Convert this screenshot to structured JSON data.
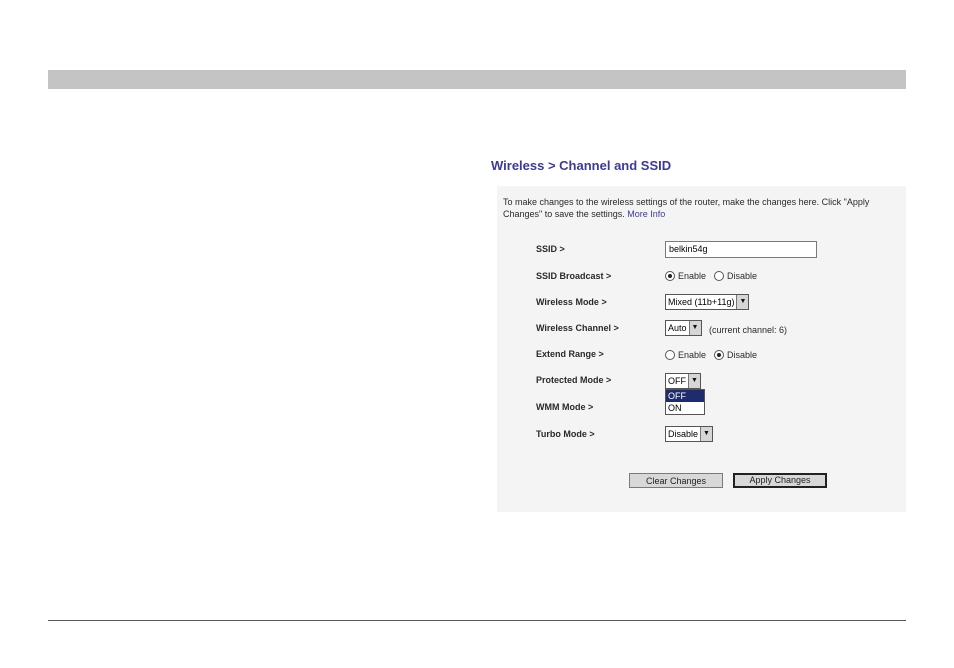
{
  "page": {
    "title": "Wireless > Channel and SSID",
    "intro": "To make changes to the wireless settings of the router, make the changes here. Click \"Apply Changes\" to save the settings.",
    "more_info": "More Info"
  },
  "fields": {
    "ssid": {
      "label": "SSID >",
      "value": "belkin54g"
    },
    "ssid_broadcast": {
      "label": "SSID Broadcast >",
      "options": [
        "Enable",
        "Disable"
      ],
      "selected": "Enable"
    },
    "wireless_mode": {
      "label": "Wireless Mode >",
      "value": "Mixed (11b+11g)"
    },
    "wireless_channel": {
      "label": "Wireless Channel >",
      "value": "Auto",
      "hint": "(current channel: 6)"
    },
    "extend_range": {
      "label": "Extend Range >",
      "options": [
        "Enable",
        "Disable"
      ],
      "selected": "Disable"
    },
    "protected_mode": {
      "label": "Protected Mode >",
      "value": "OFF",
      "options": [
        "OFF",
        "ON"
      ],
      "highlighted": "OFF"
    },
    "wmm_mode": {
      "label": "WMM Mode >"
    },
    "turbo_mode": {
      "label": "Turbo Mode >",
      "value": "Disable"
    }
  },
  "buttons": {
    "clear": "Clear Changes",
    "apply": "Apply Changes"
  },
  "icons": {
    "select_arrow": "chevron-down-icon"
  },
  "colors": {
    "title": "#3a3a9c",
    "top_bar": "#c4c4c4",
    "dropdown_highlight": "#1e2c6e"
  }
}
